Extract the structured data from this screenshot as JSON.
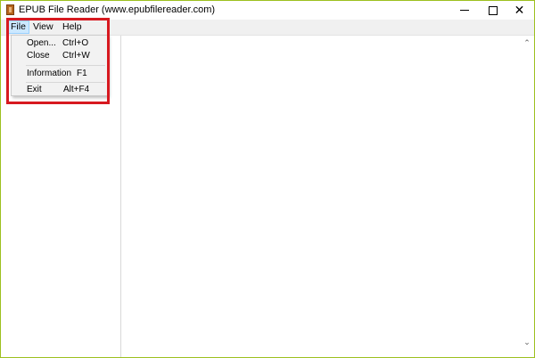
{
  "window": {
    "title": "EPUB File Reader (www.epubfilereader.com)",
    "accent_border": "#9dc01f",
    "app_icon": "book-icon",
    "controls": {
      "minimize": "minimize-icon",
      "maximize": "maximize-icon",
      "close": "close-icon",
      "close_glyph": "✕"
    }
  },
  "menubar": {
    "items": [
      {
        "label": "File",
        "state": "open"
      },
      {
        "label": "View"
      },
      {
        "label": "Help"
      }
    ]
  },
  "file_menu": {
    "items": [
      {
        "label": "Open...",
        "shortcut": "Ctrl+O"
      },
      {
        "label": "Close",
        "shortcut": "Ctrl+W"
      },
      {
        "label": "Information",
        "shortcut": "F1"
      },
      {
        "label": "Exit",
        "shortcut": "Alt+F4"
      }
    ]
  },
  "scrollbar": {
    "up_glyph": "⌃",
    "down_glyph": "⌄"
  },
  "annotation": {
    "highlight_color": "#d71920"
  }
}
